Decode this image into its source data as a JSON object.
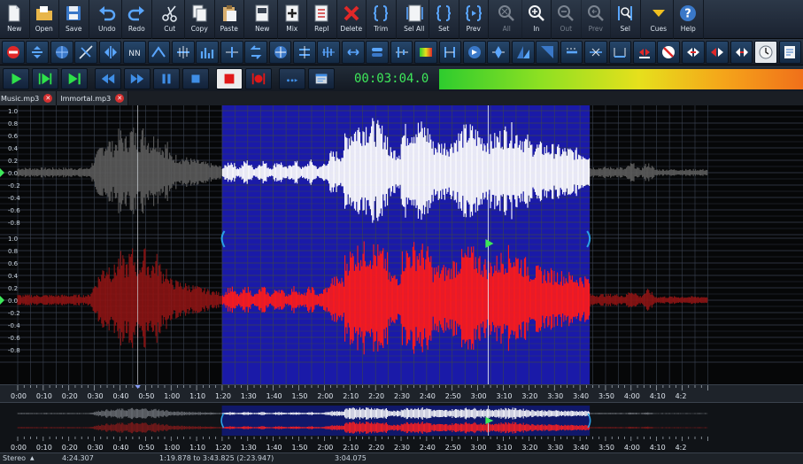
{
  "toolbar": {
    "buttons": [
      {
        "name": "new-button",
        "label": "New",
        "icon": "new-file-icon"
      },
      {
        "name": "open-button",
        "label": "Open",
        "icon": "folder-icon"
      },
      {
        "name": "save-button",
        "label": "Save",
        "icon": "floppy-icon"
      },
      {
        "name": "undo-button",
        "label": "Undo",
        "icon": "undo-icon"
      },
      {
        "name": "redo-button",
        "label": "Redo",
        "icon": "redo-icon"
      },
      {
        "name": "cut-button",
        "label": "Cut",
        "icon": "scissors-icon"
      },
      {
        "name": "copy-button",
        "label": "Copy",
        "icon": "copy-icon"
      },
      {
        "name": "paste-button",
        "label": "Paste",
        "icon": "paste-icon"
      },
      {
        "name": "new-from-selection-button",
        "label": "New",
        "icon": "document-icon"
      },
      {
        "name": "mix-button",
        "label": "Mix",
        "icon": "mix-icon"
      },
      {
        "name": "replace-button",
        "label": "Repl",
        "icon": "replace-icon"
      },
      {
        "name": "delete-button",
        "label": "Delete",
        "icon": "delete-x-icon"
      },
      {
        "name": "trim-button",
        "label": "Trim",
        "icon": "trim-icon"
      },
      {
        "name": "select-all-button",
        "label": "Sel All",
        "icon": "select-all-icon"
      },
      {
        "name": "set-button",
        "label": "Set",
        "icon": "braces-icon"
      },
      {
        "name": "prev-button",
        "label": "Prev",
        "icon": "preview-icon"
      },
      {
        "name": "zoom-all-button",
        "label": "All",
        "icon": "zoom-all-icon",
        "disabled": true
      },
      {
        "name": "zoom-in-button",
        "label": "In",
        "icon": "zoom-in-icon"
      },
      {
        "name": "zoom-out-button",
        "label": "Out",
        "icon": "zoom-out-icon",
        "disabled": true
      },
      {
        "name": "zoom-prev-button",
        "label": "Prev",
        "icon": "zoom-prev-icon",
        "disabled": true
      },
      {
        "name": "zoom-selection-button",
        "label": "Sel",
        "icon": "zoom-selection-icon"
      },
      {
        "name": "cues-button",
        "label": "Cues",
        "icon": "cues-arrow-icon"
      },
      {
        "name": "help-button",
        "label": "Help",
        "icon": "help-icon"
      }
    ]
  },
  "transport": {
    "time": "00:03:04.0"
  },
  "tabs": [
    {
      "label": "Music.mp3"
    },
    {
      "label": "Immortal.mp3"
    }
  ],
  "amplitude_ticks": [
    "1.0",
    "0.8",
    "0.6",
    "0.4",
    "0.2",
    "0.0",
    "-0.2",
    "-0.4",
    "-0.6",
    "-0.8",
    "1.0",
    "0.8",
    "0.6",
    "0.4",
    "0.2",
    "0.0",
    "-0.2",
    "-0.4",
    "-0.6",
    "-0.8"
  ],
  "timeline_ticks": [
    "0:00",
    "0:10",
    "0:20",
    "0:30",
    "0:40",
    "0:50",
    "1:00",
    "1:10",
    "1:20",
    "1:30",
    "1:40",
    "1:50",
    "2:00",
    "2:10",
    "2:20",
    "2:30",
    "2:40",
    "2:50",
    "3:00",
    "3:10",
    "3:20",
    "3:30",
    "3:40",
    "3:50",
    "4:00",
    "4:10",
    "4:2"
  ],
  "status": {
    "channels": "Stereo",
    "length": "4:24.307",
    "selection": "1:19.878 to 3:43.825 (2:23.947)",
    "position": "3:04.075"
  },
  "colors": {
    "selection_bg": "#1a1aa8",
    "left_channel_sel": "#ffffff",
    "left_channel": "#5a5a5a",
    "right_channel_sel": "#ff1a1a",
    "right_channel": "#8a1414",
    "time_display": "#3ee85a"
  }
}
